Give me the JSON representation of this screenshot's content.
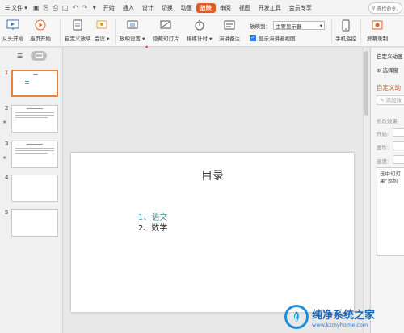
{
  "menubar": {
    "file_label": "文件",
    "tabs": [
      "开始",
      "插入",
      "设计",
      "切换",
      "动画",
      "放映",
      "审阅",
      "视图",
      "开发工具",
      "会员专享"
    ],
    "active_tab": "放映",
    "search_placeholder": "查找命令、"
  },
  "ribbon": {
    "from_start": "从头开始",
    "from_current": "当页开始",
    "custom_show": "自定义放映",
    "meeting": "会议",
    "show_settings": "放映设置",
    "hide_slide": "隐藏幻灯片",
    "rehearse": "排练计时",
    "speaker_notes": "演讲备注",
    "show_on_label": "放映到：",
    "show_on_value": "主要显示器",
    "presenter_view_label": "显示演讲者视图",
    "phone_remote": "手机遥控",
    "screen_record": "屏幕录制"
  },
  "slides": [
    {
      "number": "1",
      "selected": true
    },
    {
      "number": "2",
      "selected": false
    },
    {
      "number": "3",
      "selected": false
    },
    {
      "number": "4",
      "selected": false
    },
    {
      "number": "5",
      "selected": false
    }
  ],
  "slide": {
    "title": "目录",
    "item1": "1、语文",
    "item2": "2、数学"
  },
  "taskpane": {
    "title": "自定义动画",
    "select_pane": "选择窗",
    "custom_animation": "自定义动",
    "add_effect": "添加效",
    "modify_effect": "修改效果",
    "start_label": "开始:",
    "property_label": "属性:",
    "speed_label": "速度:",
    "hint_line1": "选中幻灯",
    "hint_line2": "果\"添加"
  },
  "watermark": {
    "name": "纯净系统之家",
    "url": "www.kzmyhome.com"
  },
  "colors": {
    "accent": "#e05d26",
    "link": "#3a9fb0",
    "watermark_blue": "#1b66b3"
  }
}
